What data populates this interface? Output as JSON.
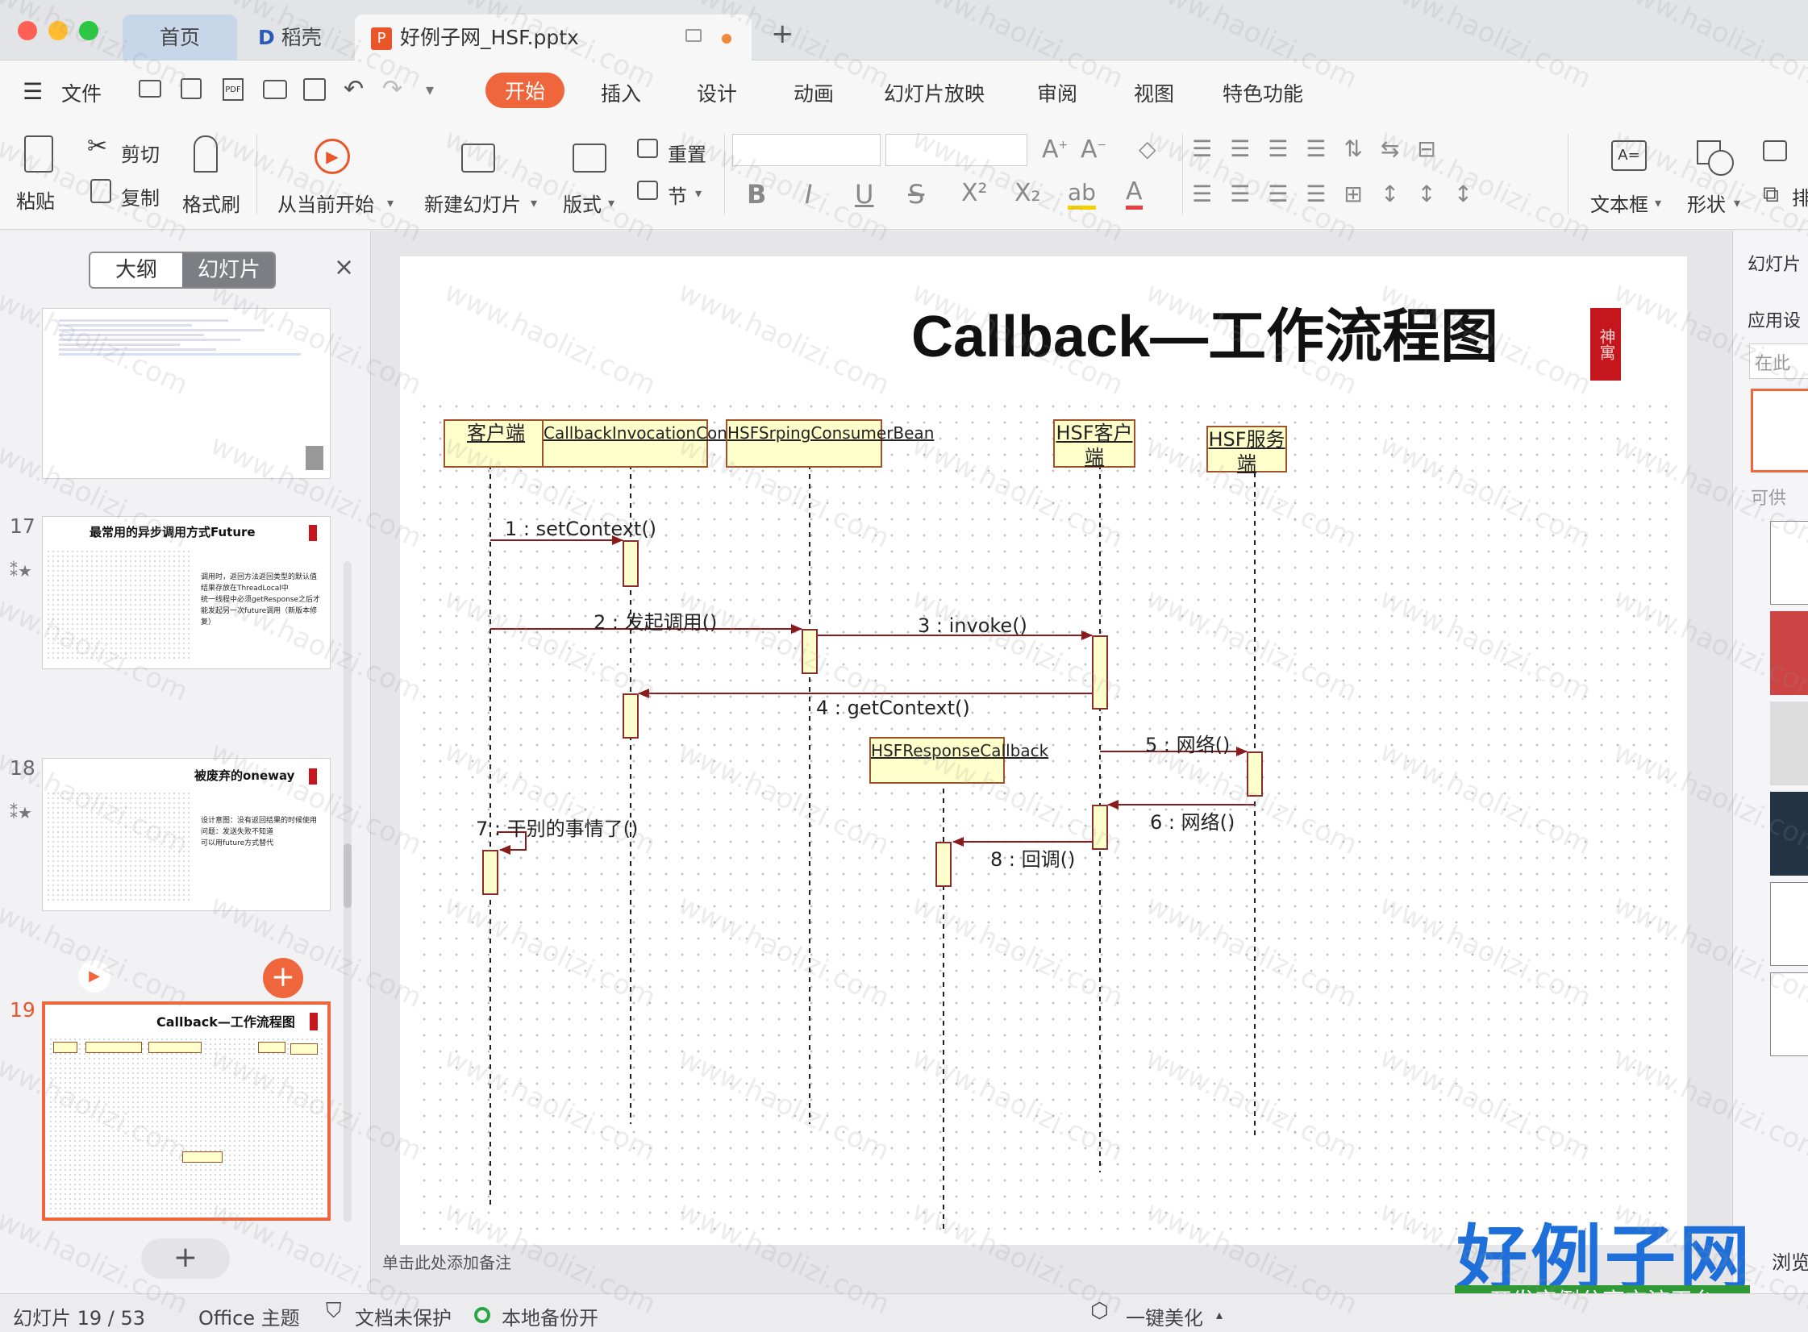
{
  "tabs": {
    "home": "首页",
    "daoke": "稻壳",
    "file": "好例子网_HSF.pptx",
    "new_tab": "+"
  },
  "menu": {
    "file": "文件",
    "items": [
      "开始",
      "插入",
      "设计",
      "动画",
      "幻灯片放映",
      "审阅",
      "视图",
      "特色功能"
    ]
  },
  "ribbon": {
    "paste": "粘贴",
    "cut": "剪切",
    "copy": "复制",
    "format_painter": "格式刷",
    "play_current": "从当前开始",
    "new_slide": "新建幻灯片",
    "layout": "版式",
    "reset": "重置",
    "section": "节",
    "textbox": "文本框",
    "shape": "形状",
    "arrange": "排"
  },
  "left_pane": {
    "outline_tab": "大纲",
    "slides_tab": "幻灯片",
    "close": "×",
    "add": "+"
  },
  "thumbnails": [
    {
      "num": "17",
      "title": "最常用的异步调用方式Future",
      "bullets": [
        "调用时，返回方法返回类型的默认值",
        "结果存放在ThreadLocal中",
        "统一线程中必须getResponse之后才能发起另一次future调用（新版本修复）"
      ]
    },
    {
      "num": "18",
      "title": "被废弃的oneway",
      "bullets": [
        "设计意图：没有返回结果的时候使用",
        "问题：发送失败不知道",
        "可以用future方式替代"
      ]
    },
    {
      "num": "19",
      "title": "Callback—工作流程图"
    }
  ],
  "slide": {
    "title": "Callback—工作流程图",
    "seal": "神寓",
    "notes_placeholder": "单击此处添加备注",
    "lifelines": [
      "客户端",
      "CallbackInvocationContext",
      "HSFSrpingConsumerBean",
      "HSF客户端",
      "HSF服务端",
      "HSFResponseCallback"
    ],
    "messages": [
      "1 : setContext()",
      "2 : 发起调用()",
      "3 : invoke()",
      "4 : getContext()",
      "5 : 网络()",
      "6 : 网络()",
      "7 : 干别的事情了()",
      "8 : 回调()"
    ]
  },
  "right_pane": {
    "slide_label": "幻灯片",
    "apply": "应用设",
    "search": "在此",
    "provide": "可供",
    "browse": "浏览"
  },
  "status": {
    "slide_pos": "幻灯片 19 / 53",
    "theme": "Office 主题",
    "protect": "文档未保护",
    "backup": "本地备份开",
    "beautify": "一键美化"
  },
  "watermark": {
    "brand": "好例子网",
    "tagline": "开发实例分享交流平台",
    "url": "www.haolizi.com"
  },
  "colors": {
    "accent": "#f0663c",
    "arrow": "#8b1a1a",
    "box_fill": "#ffffcc"
  }
}
